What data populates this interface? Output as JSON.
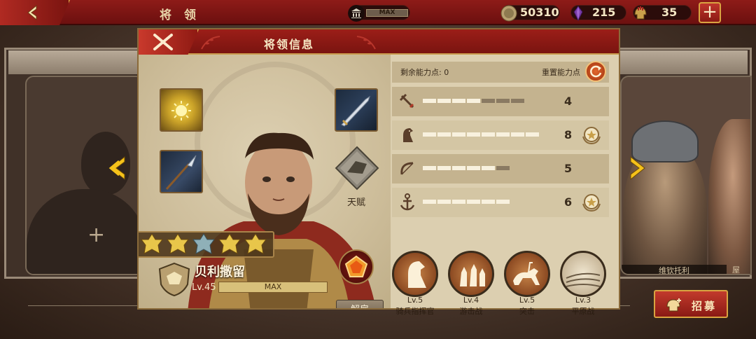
{
  "topbar": {
    "title": "将 领",
    "capacity_label": "MAX",
    "coins": "50310",
    "gems": "215",
    "helmets": "35",
    "plus_label": "+"
  },
  "background": {
    "right_hero_name": "维钦托利",
    "right_hero2_name": "屋",
    "recruit_label": "招募"
  },
  "modal": {
    "title": "将领信息",
    "talent_label": "天赋",
    "hero": {
      "name": "贝利撒留",
      "level": "Lv.45",
      "level_bar": "MAX",
      "ranks": [
        "gold",
        "gold",
        "silver",
        "gold",
        "gold"
      ]
    },
    "dismiss_label": "解雇",
    "remaining_points": "剩余能力点: 0",
    "reset_label": "重置能力点",
    "stats": [
      {
        "icon": "sword-icon",
        "value": "4",
        "filled": 4,
        "total": 7,
        "badge": false
      },
      {
        "icon": "horse-icon",
        "value": "8",
        "filled": 8,
        "total": 8,
        "badge": true
      },
      {
        "icon": "bow-icon",
        "value": "5",
        "filled": 5,
        "total": 6,
        "badge": false
      },
      {
        "icon": "anchor-icon",
        "value": "6",
        "filled": 6,
        "total": 6,
        "badge": true
      }
    ],
    "skills": [
      {
        "lv": "Lv.5",
        "name": "骑兵指挥官"
      },
      {
        "lv": "Lv.4",
        "name": "游击战"
      },
      {
        "lv": "Lv.5",
        "name": "突击"
      },
      {
        "lv": "Lv.3",
        "name": "平原战"
      }
    ]
  },
  "colors": {
    "accent_red": "#8e1b18",
    "gold": "#d9a441",
    "parchment": "#d8c9a9"
  }
}
